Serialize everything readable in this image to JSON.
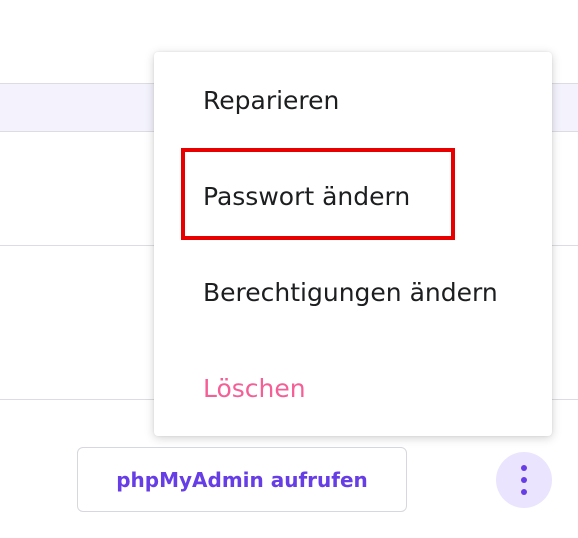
{
  "menu": {
    "items": [
      {
        "label": "Reparieren",
        "kind": "normal"
      },
      {
        "label": "Passwort ändern",
        "kind": "normal",
        "highlighted": true
      },
      {
        "label": "Berechtigungen ändern",
        "kind": "normal"
      },
      {
        "label": "Löschen",
        "kind": "danger"
      }
    ]
  },
  "actions": {
    "phpmyadmin_label": "phpMyAdmin aufrufen",
    "more_icon": "vertical-ellipsis-icon"
  },
  "colors": {
    "accent": "#673de6",
    "accent_light": "#ebe4ff",
    "danger": "#f55f96",
    "highlight": "#e80000",
    "row_band": "#f4f3fd"
  }
}
